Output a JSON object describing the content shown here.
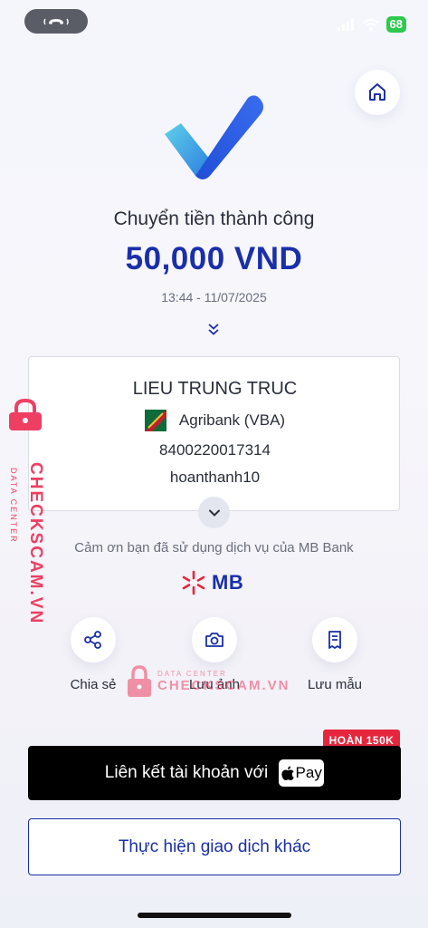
{
  "status_bar": {
    "battery": "68"
  },
  "title": "Chuyển tiền thành công",
  "amount": "50,000 VND",
  "datetime": "13:44 - 11/07/2025",
  "recipient": {
    "name": "LIEU TRUNG TRUC",
    "bank": "Agribank (VBA)",
    "account_number": "8400220017314",
    "note": "hoanthanh10"
  },
  "thanks_text": "Cảm ơn bạn đã sử dụng dịch vụ của MB Bank",
  "brand": {
    "logo_text": "MB",
    "primary_color": "#1a2fa8",
    "accent_color": "#e6263c"
  },
  "actions": [
    {
      "label": "Chia sẻ",
      "icon": "share-icon"
    },
    {
      "label": "Lưu ảnh",
      "icon": "camera-icon"
    },
    {
      "label": "Lưu mẫu",
      "icon": "receipt-icon"
    }
  ],
  "watermark": {
    "side_main": "CHECKSCAM.VN",
    "side_sub": "DATA CENTER",
    "center_sub": "DATA CENTER",
    "center_main": "CHECKSCAM.VN"
  },
  "promo": {
    "badge": "HOÀN 150K",
    "link_text": "Liên kết tài khoản với",
    "apple_pay_label": "Pay"
  },
  "other_transaction": "Thực hiện giao dịch khác"
}
